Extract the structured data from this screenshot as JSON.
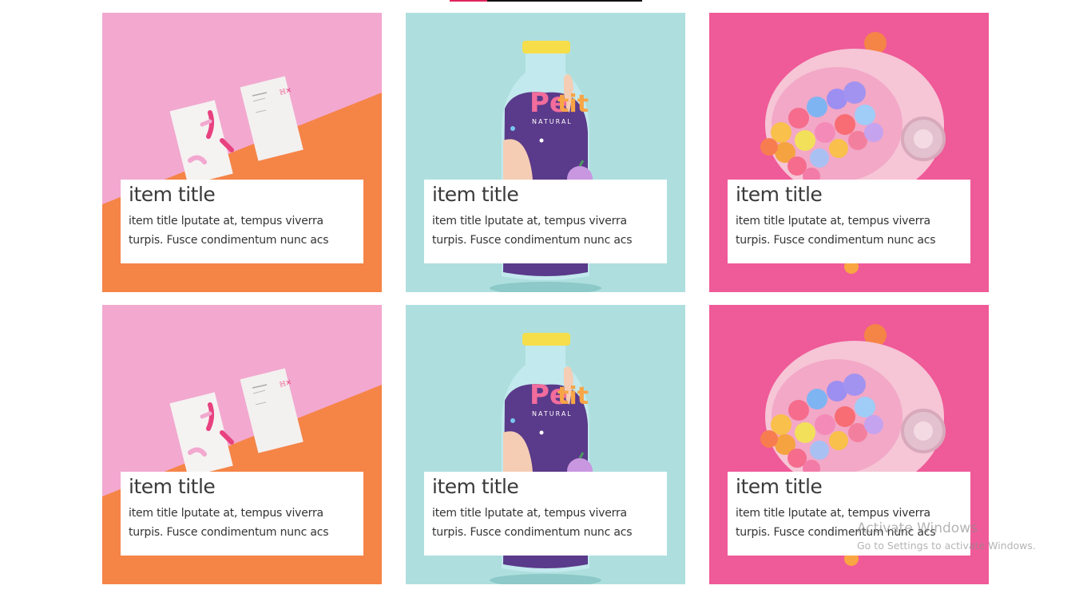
{
  "colors": {
    "pink_light": "#f2a8cf",
    "orange": "#f58447",
    "aqua": "#aedfde",
    "magenta": "#ef5a98",
    "tab_accent": "#e0245e"
  },
  "cards": [
    {
      "image": "business-cards-image",
      "title": "item title",
      "description": "item title lputate at, tempus viverra turpis. Fusce condimentum nunc acs"
    },
    {
      "image": "juice-bottle-image",
      "title": "item title",
      "description": "item title lputate at, tempus viverra turpis. Fusce condimentum nunc acs"
    },
    {
      "image": "candy-helmet-image",
      "title": "item title",
      "description": "item title lputate at, tempus viverra turpis. Fusce condimentum nunc acs"
    },
    {
      "image": "business-cards-image",
      "title": "item title",
      "description": "item title lputate at, tempus viverra turpis. Fusce condimentum nunc acs"
    },
    {
      "image": "juice-bottle-image",
      "title": "item title",
      "description": "item title lputate at, tempus viverra turpis. Fusce condimentum nunc acs"
    },
    {
      "image": "candy-helmet-image",
      "title": "item title",
      "description": "item title lputate at, tempus viverra turpis. Fusce condimentum nunc acs"
    }
  ],
  "watermark": {
    "title": "Activate Windows",
    "subtitle": "Go to Settings to activate Windows."
  }
}
